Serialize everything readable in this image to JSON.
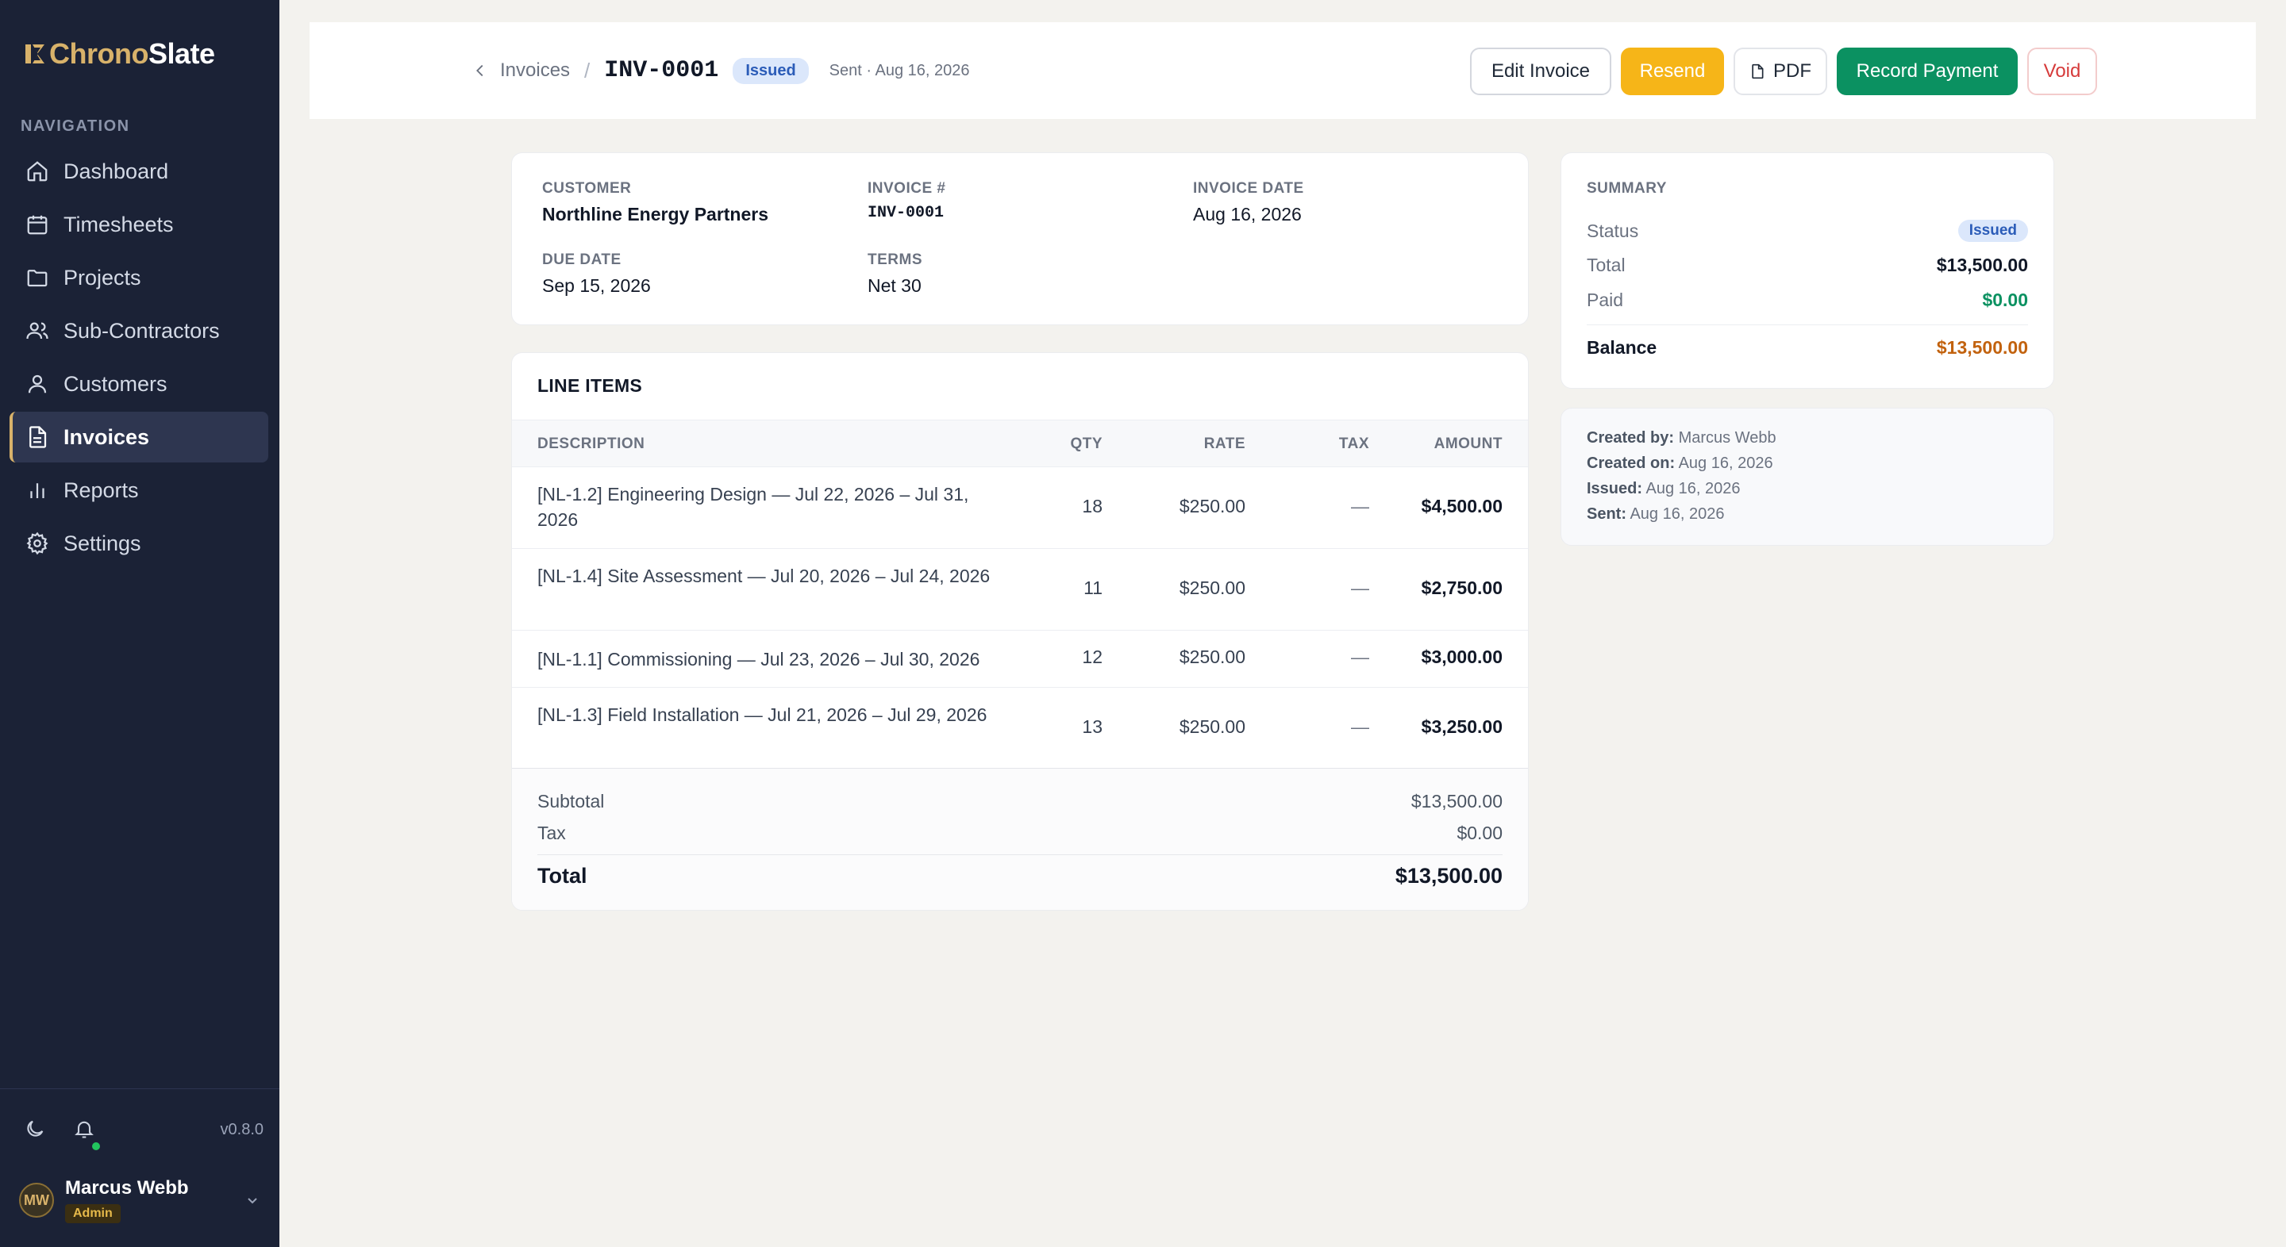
{
  "app": {
    "logo_prefix": "Chrono",
    "logo_suffix": "Slate",
    "brand_color": "#d8b26a"
  },
  "sidebar": {
    "heading": "NAVIGATION",
    "items": [
      {
        "label": "Dashboard",
        "icon": "home-icon"
      },
      {
        "label": "Timesheets",
        "icon": "calendar-icon"
      },
      {
        "label": "Projects",
        "icon": "folder-icon"
      },
      {
        "label": "Sub-Contractors",
        "icon": "users-icon"
      },
      {
        "label": "Customers",
        "icon": "user-icon"
      },
      {
        "label": "Invoices",
        "icon": "document-icon",
        "active": true
      },
      {
        "label": "Reports",
        "icon": "bar-chart-icon"
      },
      {
        "label": "Settings",
        "icon": "gear-icon"
      }
    ],
    "version": "v0.8.0",
    "user": {
      "initials": "MW",
      "name": "Marcus Webb",
      "role": "Admin"
    }
  },
  "header": {
    "back_label": "Invoices",
    "separator": "/",
    "invoice_id": "INV-0001",
    "status": "Issued",
    "sent_meta": "Sent · Aug 16, 2026",
    "actions": {
      "edit": "Edit Invoice",
      "resend": "Resend",
      "pdf": "PDF",
      "record": "Record Payment",
      "void": "Void"
    }
  },
  "details": {
    "customer_label": "CUSTOMER",
    "customer": "Northline Energy Partners",
    "invoice_no_label": "INVOICE #",
    "invoice_no": "INV-0001",
    "invoice_date_label": "INVOICE DATE",
    "invoice_date": "Aug 16, 2026",
    "due_date_label": "DUE DATE",
    "due_date": "Sep 15, 2026",
    "terms_label": "TERMS",
    "terms": "Net 30"
  },
  "line_items": {
    "title": "LINE ITEMS",
    "columns": {
      "description": "DESCRIPTION",
      "qty": "QTY",
      "rate": "RATE",
      "tax": "TAX",
      "amount": "AMOUNT"
    },
    "rows": [
      {
        "description": "[NL-1.2] Engineering Design — Jul 22, 2026 – Jul 31, 2026",
        "qty": "18",
        "rate": "$250.00",
        "tax": "—",
        "amount": "$4,500.00"
      },
      {
        "description": "[NL-1.4] Site Assessment — Jul 20, 2026 – Jul 24, 2026",
        "qty": "11",
        "rate": "$250.00",
        "tax": "—",
        "amount": "$2,750.00"
      },
      {
        "description": "[NL-1.1] Commissioning — Jul 23, 2026 – Jul 30, 2026",
        "qty": "12",
        "rate": "$250.00",
        "tax": "—",
        "amount": "$3,000.00"
      },
      {
        "description": "[NL-1.3] Field Installation — Jul 21, 2026 – Jul 29, 2026",
        "qty": "13",
        "rate": "$250.00",
        "tax": "—",
        "amount": "$3,250.00"
      }
    ],
    "subtotal_label": "Subtotal",
    "subtotal": "$13,500.00",
    "tax_label": "Tax",
    "tax": "$0.00",
    "total_label": "Total",
    "total": "$13,500.00"
  },
  "summary": {
    "title": "SUMMARY",
    "status_label": "Status",
    "status": "Issued",
    "total_label": "Total",
    "total": "$13,500.00",
    "paid_label": "Paid",
    "paid": "$0.00",
    "balance_label": "Balance",
    "balance": "$13,500.00"
  },
  "audit": {
    "created_by_label": "Created by:",
    "created_by": "Marcus Webb",
    "created_on_label": "Created on:",
    "created_on": "Aug 16, 2026",
    "issued_label": "Issued:",
    "issued": "Aug 16, 2026",
    "sent_label": "Sent:",
    "sent": "Aug 16, 2026"
  }
}
